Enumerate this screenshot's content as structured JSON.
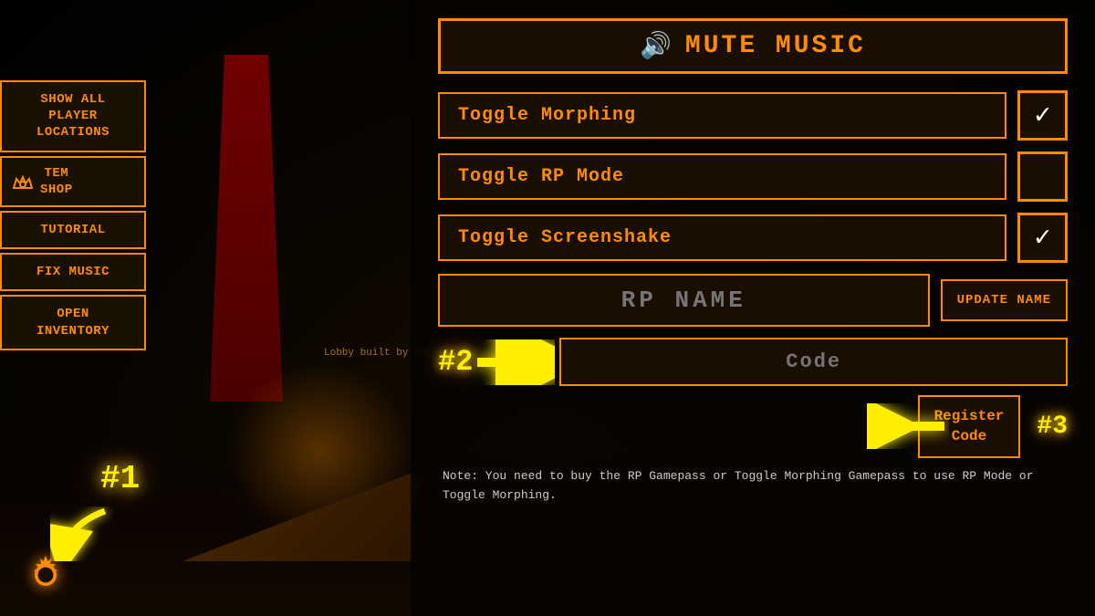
{
  "colors": {
    "orange": "#ff8c00",
    "yellow": "#ffee00",
    "dark_bg": "#1a0e00",
    "text_light": "#cccccc",
    "white": "#ffffff"
  },
  "sidebar": {
    "buttons": [
      {
        "id": "show-all-players",
        "label": "Show All Player Locations",
        "multiline": true
      },
      {
        "id": "tem-shop",
        "label": "TEM SHOP",
        "icon": "⚙"
      },
      {
        "id": "tutorial",
        "label": "Tutorial"
      },
      {
        "id": "fix-music",
        "label": "Fix Music"
      },
      {
        "id": "open-inventory",
        "label": "OPEN INVENTORY",
        "multiline": true
      }
    ]
  },
  "panel": {
    "mute_music_label": "MUTE MUSIC",
    "mute_icon": "🔊",
    "toggles": [
      {
        "id": "toggle-morphing",
        "label": "Toggle Morphing",
        "checked": true
      },
      {
        "id": "toggle-rp-mode",
        "label": "Toggle RP Mode",
        "checked": false
      },
      {
        "id": "toggle-screenshake",
        "label": "Toggle Screenshake",
        "checked": true
      }
    ],
    "rp_name": {
      "placeholder": "RP NAME",
      "update_btn_label": "UPDATE NAME"
    },
    "code": {
      "hash_label": "#2",
      "placeholder": "Code"
    },
    "register": {
      "arrow_label": "#3",
      "btn_label": "Register\nCode"
    },
    "note": "Note:  You need to buy the RP Gamepass or Toggle Morphing Gamepass to use RP Mode or Toggle Morphing."
  },
  "lobby_text": "Lobby built by\n$Noblus",
  "markers": {
    "hash1": "#1",
    "hash2": "#2",
    "hash3": "#3"
  }
}
